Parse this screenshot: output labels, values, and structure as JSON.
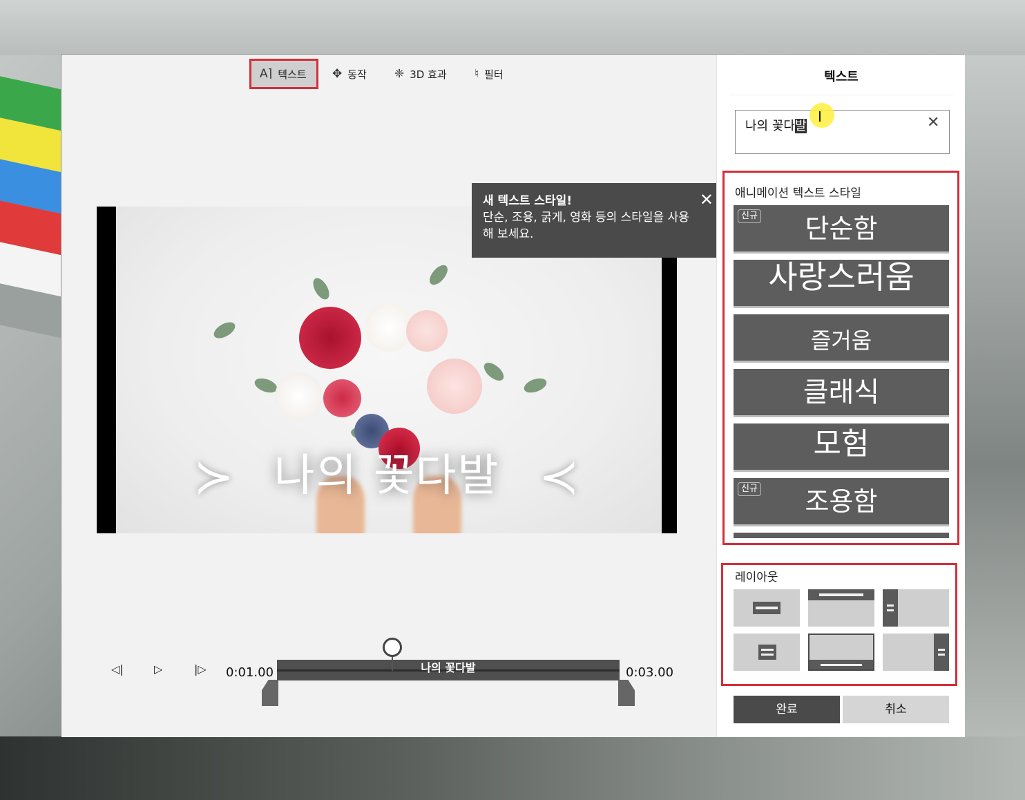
{
  "toolbar": {
    "text_label": "텍스트",
    "motion_label": "동작",
    "effects_label": "3D 효과",
    "filter_label": "필터"
  },
  "preview": {
    "overlay_text": "나의 꽃다발"
  },
  "tooltip": {
    "title": "새 텍스트 스타일!",
    "body": "단순, 조용, 굵게, 영화 등의 스타일을 사용해 보세요."
  },
  "timeline": {
    "start_time": "0:01.00",
    "end_time": "0:03.00",
    "clip_label": "나의 꽃다발"
  },
  "panel": {
    "title": "텍스트",
    "input_value_prefix": "나의 꽃다",
    "input_value_selected": "발",
    "styles_label": "애니메이션 텍스트 스타일",
    "styles": [
      {
        "name": "단순함",
        "badge": "신규"
      },
      {
        "name": "사랑스러움",
        "badge": ""
      },
      {
        "name": "즐거움",
        "badge": ""
      },
      {
        "name": "클래식",
        "badge": ""
      },
      {
        "name": "모험",
        "badge": ""
      },
      {
        "name": "조용함",
        "badge": "신규"
      }
    ],
    "layout_label": "레이아웃",
    "done_label": "완료",
    "cancel_label": "취소"
  },
  "colors": {
    "highlight_red": "#d32f3a",
    "card_gray": "#5d5d5d",
    "cursor_yellow": "#fff03c"
  }
}
